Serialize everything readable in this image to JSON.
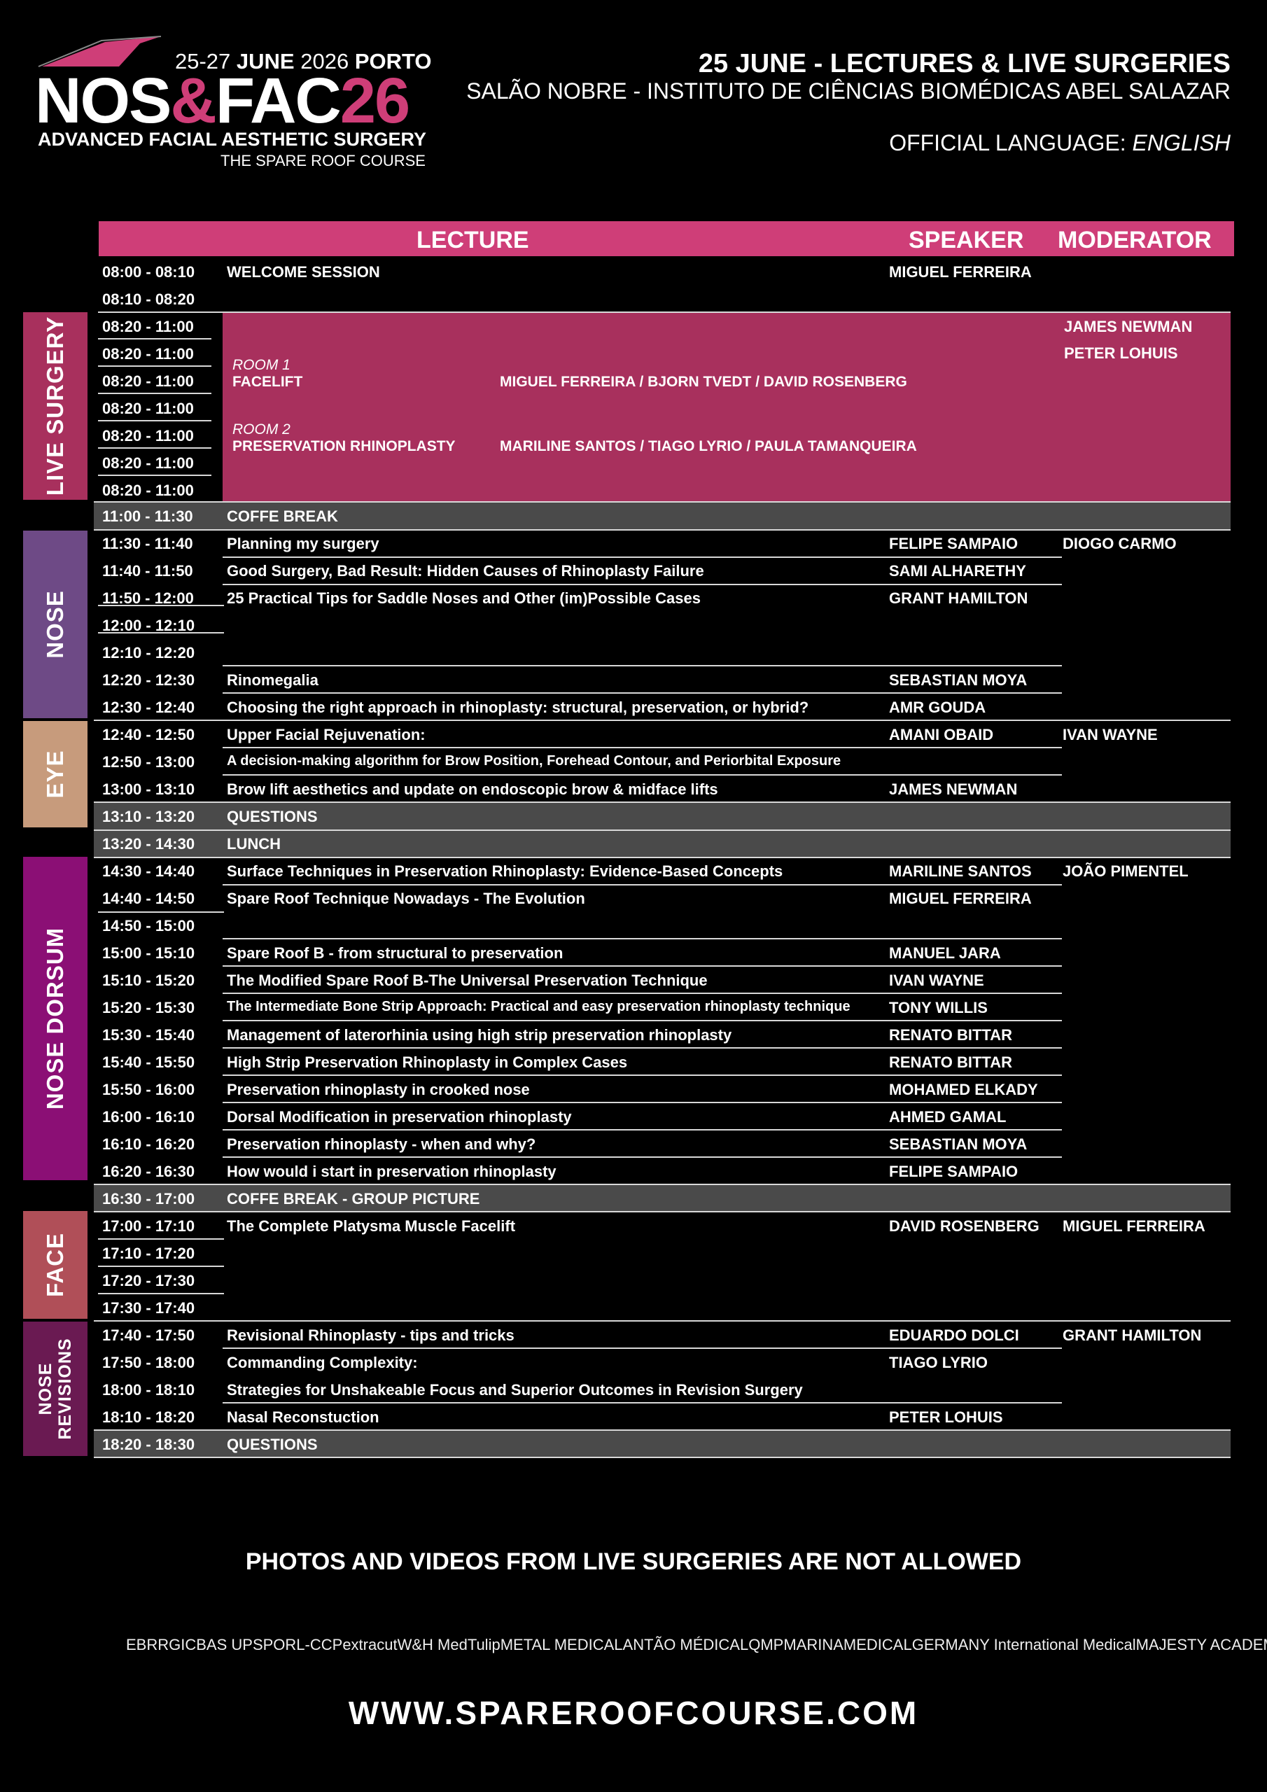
{
  "logo": {
    "dates_prefix": "25-27 ",
    "dates_month": "JUNE",
    "dates_year": " 2026 ",
    "dates_city": "PORTO",
    "name_a": "NOS",
    "name_amp": "&",
    "name_b": "FAC",
    "name_num": "26",
    "subtitle": "ADVANCED FACIAL AESTHETIC SURGERY",
    "course": "THE SPARE ROOF COURSE"
  },
  "header": {
    "title": "25 JUNE - LECTURES & LIVE SURGERIES",
    "venue": "SALÃO NOBRE - INSTITUTO DE CIÊNCIAS BIOMÉDICAS ABEL SALAZAR",
    "language_label": "OFFICIAL LANGUAGE: ",
    "language_value": "ENGLISH"
  },
  "table_header": {
    "lecture": "LECTURE",
    "speaker": "SPEAKER",
    "moderator": "MODERATOR"
  },
  "colors": {
    "pink": "#cf3e78",
    "live": "#a8305d",
    "nose": "#6e4a86",
    "eye": "#c79b7c",
    "dorsum": "#8b0f75",
    "face": "#b04f58",
    "revisions": "#6a1a52",
    "break": "#4a4a4a"
  },
  "sections": {
    "live": "LIVE SURGERY",
    "nose": "NOSE",
    "eye": "EYE",
    "dorsum": "NOSE DORSUM",
    "face": "FACE",
    "revisions_1": "NOSE",
    "revisions_2": "REVISIONS"
  },
  "live_surgery": {
    "times": [
      "08:20 - 11:00",
      "08:20 - 11:00",
      "08:20 - 11:00",
      "08:20 - 11:00",
      "08:20 - 11:00",
      "08:20 - 11:00",
      "08:20 - 11:00"
    ],
    "room1_label": "ROOM 1",
    "room1_title": "FACELIFT",
    "room1_speakers": "MIGUEL FERREIRA  /  BJORN TVEDT  /  DAVID ROSENBERG",
    "room2_label": "ROOM 2",
    "room2_title": "PRESERVATION RHINOPLASTY",
    "room2_speakers": "MARILINE SANTOS  /  TIAGO LYRIO  /  PAULA TAMANQUEIRA",
    "moderator_1": "JAMES NEWMAN",
    "moderator_2": "PETER LOHUIS"
  },
  "rows": [
    {
      "time": "08:00 - 08:10",
      "lecture": "WELCOME SESSION",
      "speaker": "MIGUEL FERREIRA",
      "moderator": "",
      "kind": "plain"
    },
    {
      "time": "08:10 - 08:20",
      "lecture": "",
      "speaker": "",
      "moderator": "",
      "kind": "plain"
    },
    {
      "time": "11:00 - 11:30",
      "lecture": "COFFE BREAK",
      "speaker": "",
      "moderator": "",
      "kind": "grey"
    },
    {
      "time": "11:30 - 11:40",
      "lecture": "Planning my surgery",
      "speaker": "FELIPE SAMPAIO",
      "moderator": "DIOGO CARMO",
      "kind": "plain"
    },
    {
      "time": "11:40 - 11:50",
      "lecture": "Good Surgery, Bad Result: Hidden Causes of Rhinoplasty Failure",
      "speaker": "SAMI ALHARETHY",
      "moderator": "",
      "kind": "plain"
    },
    {
      "time": "11:50 - 12:00",
      "lecture": "25 Practical Tips for Saddle Noses and Other (im)Possible Cases",
      "speaker": "GRANT HAMILTON",
      "moderator": "",
      "kind": "plain"
    },
    {
      "time": "12:00 - 12:10",
      "lecture": "",
      "speaker": "",
      "moderator": "",
      "kind": "plain"
    },
    {
      "time": "12:10 - 12:20",
      "lecture": "",
      "speaker": "",
      "moderator": "",
      "kind": "plain"
    },
    {
      "time": "12:20 - 12:30",
      "lecture": "Rinomegalia",
      "speaker": "SEBASTIAN MOYA",
      "moderator": "",
      "kind": "plain"
    },
    {
      "time": "12:30 - 12:40",
      "lecture": "Choosing the right approach in rhinoplasty: structural, preservation, or hybrid?",
      "speaker": "AMR GOUDA",
      "moderator": "",
      "kind": "plain"
    },
    {
      "time": "12:40 - 12:50",
      "lecture": "Upper Facial Rejuvenation:",
      "speaker": "AMANI OBAID",
      "moderator": "IVAN WAYNE",
      "kind": "plain"
    },
    {
      "time": "12:50 - 13:00",
      "lecture": "A decision-making algorithm for Brow Position, Forehead Contour, and Periorbital Exposure",
      "speaker": "",
      "moderator": "",
      "kind": "plain",
      "small": true
    },
    {
      "time": "13:00 - 13:10",
      "lecture": "Brow lift aesthetics and update on endoscopic brow & midface lifts",
      "speaker": "JAMES NEWMAN",
      "moderator": "",
      "kind": "plain"
    },
    {
      "time": "13:10 - 13:20",
      "lecture": "QUESTIONS",
      "speaker": "",
      "moderator": "",
      "kind": "grey"
    },
    {
      "time": "13:20 - 14:30",
      "lecture": "LUNCH",
      "speaker": "",
      "moderator": "",
      "kind": "grey"
    },
    {
      "time": "14:30 - 14:40",
      "lecture": "Surface Techniques in Preservation Rhinoplasty: Evidence-Based Concepts",
      "speaker": "MARILINE SANTOS",
      "moderator": "JOÃO PIMENTEL",
      "kind": "plain"
    },
    {
      "time": "14:40 - 14:50",
      "lecture": "Spare Roof Technique Nowadays - The Evolution",
      "speaker": "MIGUEL FERREIRA",
      "moderator": "",
      "kind": "plain"
    },
    {
      "time": "14:50 - 15:00",
      "lecture": "",
      "speaker": "",
      "moderator": "",
      "kind": "plain"
    },
    {
      "time": "15:00 - 15:10",
      "lecture": "Spare Roof B - from structural to preservation",
      "speaker": "MANUEL JARA",
      "moderator": "",
      "kind": "plain"
    },
    {
      "time": "15:10 - 15:20",
      "lecture": "The Modified Spare Roof B-The Universal Preservation Technique",
      "speaker": "IVAN WAYNE",
      "moderator": "",
      "kind": "plain"
    },
    {
      "time": "15:20 - 15:30",
      "lecture": "The Intermediate Bone Strip Approach: Practical and easy preservation rhinoplasty technique",
      "speaker": "TONY WILLIS",
      "moderator": "",
      "kind": "plain",
      "small": true
    },
    {
      "time": "15:30 - 15:40",
      "lecture": "Management of laterorhinia using high strip preservation rhinoplasty",
      "speaker": "RENATO BITTAR",
      "moderator": "",
      "kind": "plain"
    },
    {
      "time": "15:40 - 15:50",
      "lecture": "High Strip Preservation Rhinoplasty in Complex Cases",
      "speaker": "RENATO BITTAR",
      "moderator": "",
      "kind": "plain"
    },
    {
      "time": "15:50 - 16:00",
      "lecture": "Preservation rhinoplasty in crooked nose",
      "speaker": "MOHAMED ELKADY",
      "moderator": "",
      "kind": "plain"
    },
    {
      "time": "16:00 - 16:10",
      "lecture": "Dorsal Modification in preservation rhinoplasty",
      "speaker": "AHMED GAMAL",
      "moderator": "",
      "kind": "plain"
    },
    {
      "time": "16:10 - 16:20",
      "lecture": "Preservation rhinoplasty - when and why?",
      "speaker": "SEBASTIAN MOYA",
      "moderator": "",
      "kind": "plain"
    },
    {
      "time": "16:20 - 16:30",
      "lecture": "How would i start in preservation rhinoplasty",
      "speaker": "FELIPE SAMPAIO",
      "moderator": "",
      "kind": "plain"
    },
    {
      "time": "16:30 - 17:00",
      "lecture": "COFFE BREAK  -  GROUP PICTURE",
      "speaker": "",
      "moderator": "",
      "kind": "grey"
    },
    {
      "time": "17:00 - 17:10",
      "lecture": "The Complete Platysma Muscle Facelift",
      "speaker": "DAVID ROSENBERG",
      "moderator": "MIGUEL FERREIRA",
      "kind": "plain"
    },
    {
      "time": "17:10 - 17:20",
      "lecture": "",
      "speaker": "",
      "moderator": "",
      "kind": "plain"
    },
    {
      "time": "17:20 - 17:30",
      "lecture": "",
      "speaker": "",
      "moderator": "",
      "kind": "plain"
    },
    {
      "time": "17:30 - 17:40",
      "lecture": "",
      "speaker": "",
      "moderator": "",
      "kind": "plain"
    },
    {
      "time": "17:40 - 17:50",
      "lecture": "Revisional Rhinoplasty - tips and tricks",
      "speaker": "EDUARDO DOLCI",
      "moderator": "GRANT HAMILTON",
      "kind": "plain"
    },
    {
      "time": "17:50 - 18:00",
      "lecture": "Commanding Complexity:",
      "speaker": "TIAGO LYRIO",
      "moderator": "",
      "kind": "plain"
    },
    {
      "time": "18:00 - 18:10",
      "lecture": "Strategies for Unshakeable Focus and Superior Outcomes in Revision Surgery",
      "speaker": "",
      "moderator": "",
      "kind": "plain"
    },
    {
      "time": "18:10 - 18:20",
      "lecture": "Nasal Reconstuction",
      "speaker": "PETER LOHUIS",
      "moderator": "",
      "kind": "plain"
    },
    {
      "time": "18:20 - 18:30",
      "lecture": "QUESTIONS",
      "speaker": "",
      "moderator": "",
      "kind": "grey"
    }
  ],
  "notice": "PHOTOS AND VIDEOS FROM LIVE SURGERIES ARE NOT ALLOWED",
  "sponsors": [
    "EBRRG",
    "ICBAS UP",
    "SPORL-CCP",
    "extracut",
    "W&H Med",
    "Tulip",
    "METAL MEDICAL",
    "ANTÃO MÉDICAL",
    "QMP",
    "MARINAMEDICAL",
    "GERMANY International Medical",
    "MAJESTY ACADEMY"
  ],
  "website": "WWW.SPAREROOFCOURSE.COM"
}
